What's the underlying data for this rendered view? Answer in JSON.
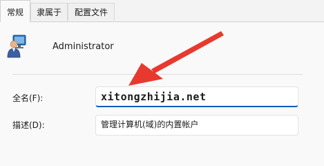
{
  "tabs": [
    {
      "label": "常规",
      "active": true
    },
    {
      "label": "隶属于",
      "active": false
    },
    {
      "label": "配置文件",
      "active": false
    }
  ],
  "user": {
    "name": "Administrator",
    "icon": "user-account-icon"
  },
  "form": {
    "fullname_label": "全名(F):",
    "fullname_value": "xitongzhijia.net",
    "description_label": "描述(D):",
    "description_value": "管理计算机(域)的内置帐户"
  },
  "colors": {
    "accent": "#005fb8",
    "annotation_arrow": "#e8392f"
  },
  "annotation": {
    "icon": "red-arrow-annotation"
  }
}
